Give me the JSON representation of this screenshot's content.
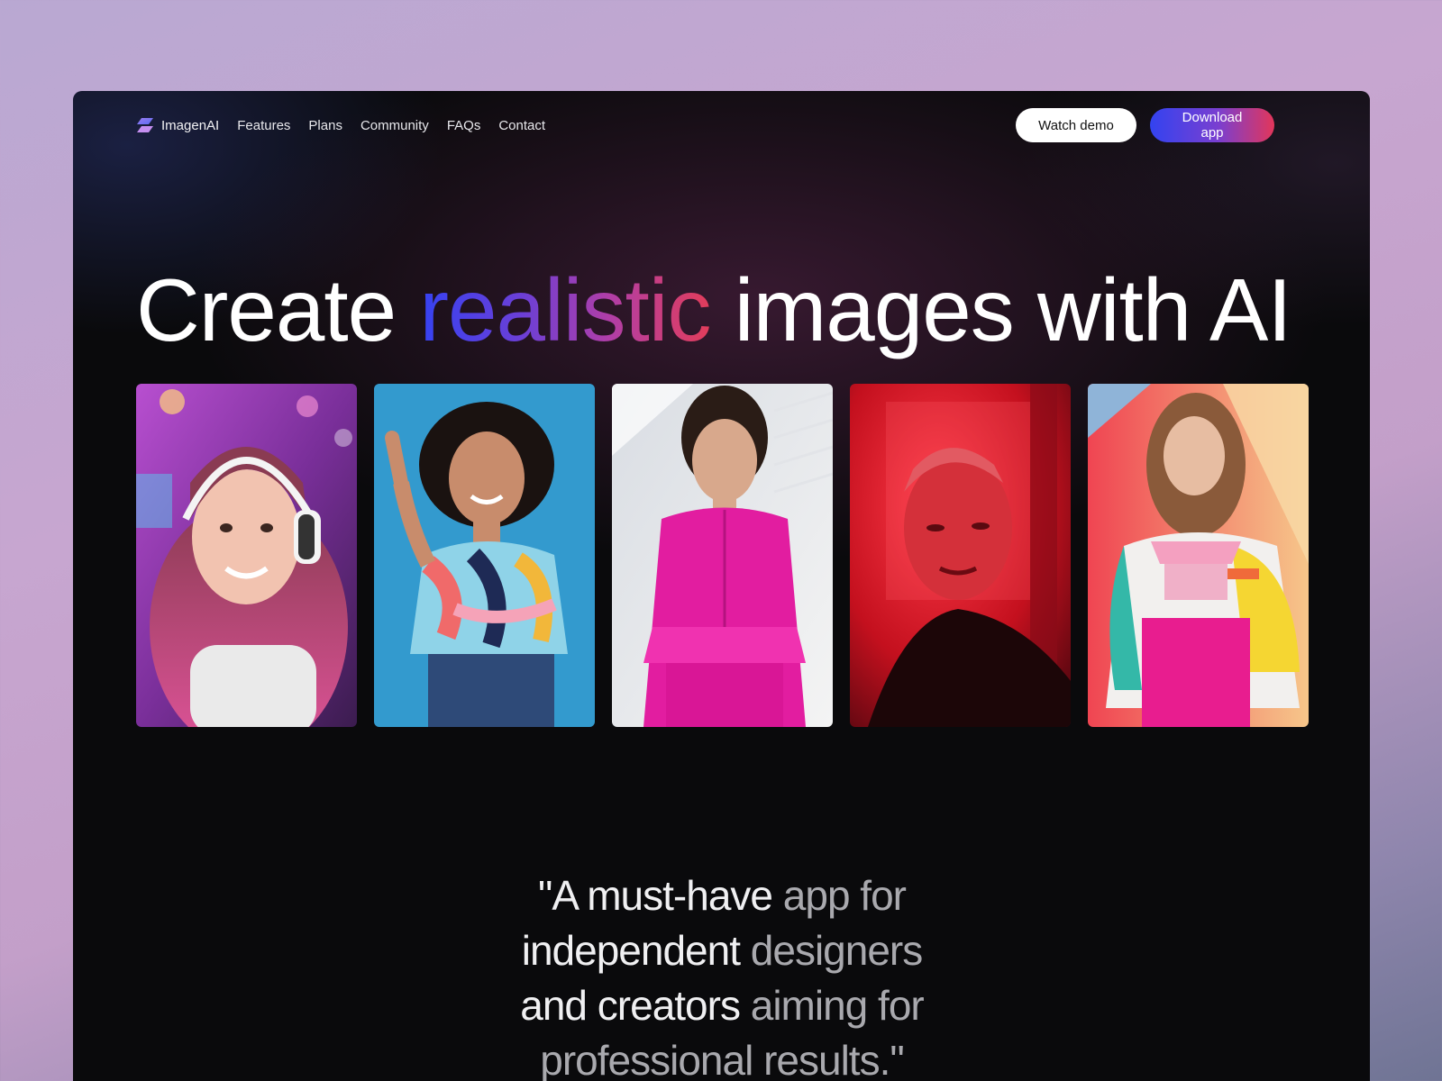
{
  "brand": {
    "name": "ImagenAI",
    "logo": "imagenai-logo-icon"
  },
  "nav": {
    "links": [
      "Features",
      "Plans",
      "Community",
      "FAQs",
      "Contact"
    ]
  },
  "actions": {
    "watch_demo": "Watch demo",
    "download_app": "Download app"
  },
  "hero": {
    "title_before": "Create ",
    "title_accent": "realistic",
    "title_after": " images with AI"
  },
  "gallery": [
    {
      "name": "woman-headphones-pink-hair-photo"
    },
    {
      "name": "woman-curly-hair-colorful-top-photo"
    },
    {
      "name": "woman-magenta-suit-photo"
    },
    {
      "name": "person-red-light-portrait-photo"
    },
    {
      "name": "woman-colorful-jacket-photo"
    }
  ],
  "quote": {
    "line1_a": "\"A must-have ",
    "line1_b": "app for",
    "line2_a": "independent ",
    "line2_b": "designers",
    "line3_a": "and creators ",
    "line3_b": "aiming for",
    "line4": "professional results.\""
  },
  "colors": {
    "accent_start": "#3343f0",
    "accent_mid": "#7a3fd0",
    "accent_end": "#e2365a",
    "background": "#0a0a0c"
  }
}
